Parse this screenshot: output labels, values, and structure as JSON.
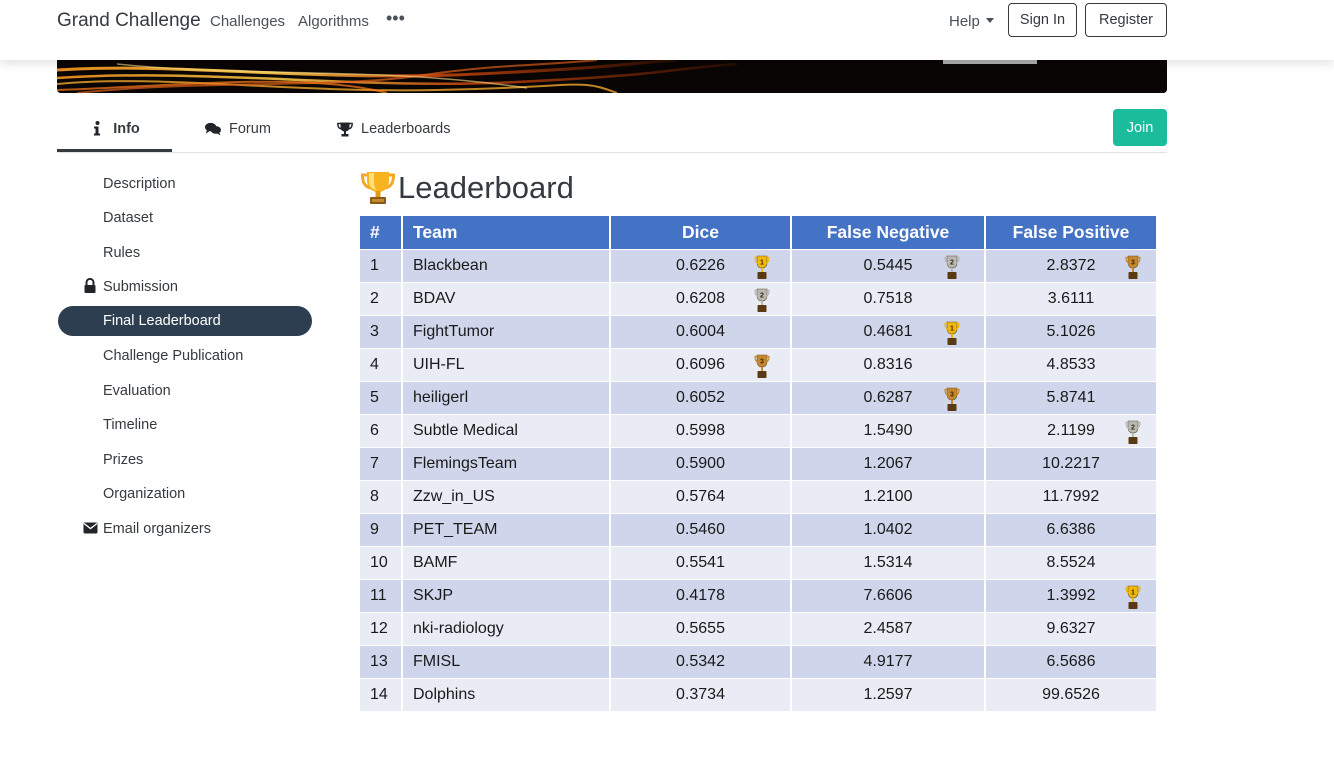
{
  "navbar": {
    "brand": "Grand Challenge",
    "links": [
      "Challenges",
      "Algorithms"
    ],
    "more": "•••",
    "help": "Help",
    "sign_in": "Sign In",
    "register": "Register"
  },
  "tabs": {
    "info": "Info",
    "forum": "Forum",
    "leaderboards": "Leaderboards",
    "join": "Join"
  },
  "sidebar": {
    "items": [
      {
        "label": "Description"
      },
      {
        "label": "Dataset"
      },
      {
        "label": "Rules"
      },
      {
        "label": "Submission",
        "icon": "lock-icon"
      },
      {
        "label": "Final Leaderboard",
        "active": true
      },
      {
        "label": "Challenge Publication"
      },
      {
        "label": "Evaluation"
      },
      {
        "label": "Timeline"
      },
      {
        "label": "Prizes"
      },
      {
        "label": "Organization"
      },
      {
        "label": "Email organizers",
        "icon": "envelope-icon"
      }
    ]
  },
  "main": {
    "title": "Leaderboard",
    "columns": [
      "#",
      "Team",
      "Dice",
      "False Negative",
      "False Positive"
    ],
    "rows": [
      {
        "rank": "1",
        "team": "Blackbean",
        "dice": "0.6226",
        "fn": "0.5445",
        "fp": "2.8372",
        "dice_place": "1",
        "fn_place": "2",
        "fp_place": "3"
      },
      {
        "rank": "2",
        "team": "BDAV",
        "dice": "0.6208",
        "fn": "0.7518",
        "fp": "3.6111",
        "dice_place": "2"
      },
      {
        "rank": "3",
        "team": "FightTumor",
        "dice": "0.6004",
        "fn": "0.4681",
        "fp": "5.1026",
        "fn_place": "1"
      },
      {
        "rank": "4",
        "team": "UIH-FL",
        "dice": "0.6096",
        "fn": "0.8316",
        "fp": "4.8533",
        "dice_place": "3"
      },
      {
        "rank": "5",
        "team": "heiligerl",
        "dice": "0.6052",
        "fn": "0.6287",
        "fp": "5.8741",
        "fn_place": "3"
      },
      {
        "rank": "6",
        "team": "Subtle Medical",
        "dice": "0.5998",
        "fn": "1.5490",
        "fp": "2.1199",
        "fp_place": "2"
      },
      {
        "rank": "7",
        "team": "FlemingsTeam",
        "dice": "0.5900",
        "fn": "1.2067",
        "fp": "10.2217"
      },
      {
        "rank": "8",
        "team": "Zzw_in_US",
        "dice": "0.5764",
        "fn": "1.2100",
        "fp": "11.7992"
      },
      {
        "rank": "9",
        "team": "PET_TEAM",
        "dice": "0.5460",
        "fn": "1.0402",
        "fp": "6.6386"
      },
      {
        "rank": "10",
        "team": "BAMF",
        "dice": "0.5541",
        "fn": "1.5314",
        "fp": "8.5524"
      },
      {
        "rank": "11",
        "team": "SKJP",
        "dice": "0.4178",
        "fn": "7.6606",
        "fp": "1.3992",
        "fp_place": "1"
      },
      {
        "rank": "12",
        "team": "nki-radiology",
        "dice": "0.5655",
        "fn": "2.4587",
        "fp": "9.6327"
      },
      {
        "rank": "13",
        "team": "FMISL",
        "dice": "0.5342",
        "fn": "4.9177",
        "fp": "6.5686"
      },
      {
        "rank": "14",
        "team": "Dolphins",
        "dice": "0.3734",
        "fn": "1.2597",
        "fp": "99.6526"
      }
    ]
  },
  "colors": {
    "header_blue": "#4472c4",
    "row_dark": "#cfd5ea",
    "row_light": "#e9ebf5",
    "join_green": "#1abc9c",
    "sidebar_active": "#2d3e50",
    "gold": "#f2b705",
    "silver": "#b8b8b8",
    "bronze": "#c8862e"
  }
}
